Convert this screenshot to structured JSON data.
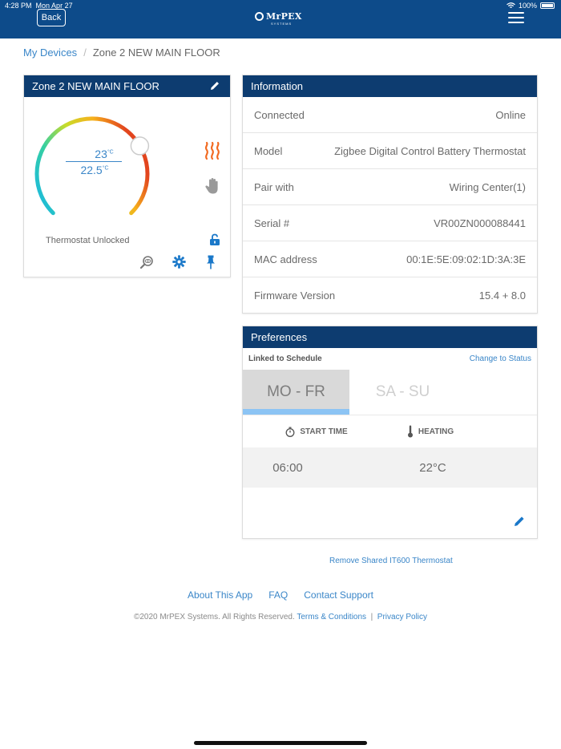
{
  "status_bar": {
    "time": "4:28 PM",
    "date": "Mon Apr 27",
    "battery": "100%"
  },
  "header": {
    "back_label": "Back",
    "logo_text": "MrPEX",
    "logo_sub": "SYSTEMS"
  },
  "breadcrumb": {
    "root": "My Devices",
    "separator": "/",
    "current": "Zone 2 NEW MAIN FLOOR"
  },
  "thermostat": {
    "title": "Zone 2 NEW MAIN FLOOR",
    "setpoint": "23",
    "current_temp": "22.5",
    "unit": "°C",
    "lock_status": "Thermostat Unlocked",
    "dial_level": 0.72
  },
  "information": {
    "title": "Information",
    "rows": [
      {
        "label": "Connected",
        "value": "Online"
      },
      {
        "label": "Model",
        "value": "Zigbee Digital Control Battery Thermostat"
      },
      {
        "label": "Pair with",
        "value": "Wiring Center(1)"
      },
      {
        "label": "Serial #",
        "value": "VR00ZN000088441"
      },
      {
        "label": "MAC address",
        "value": "00:1E:5E:09:02:1D:3A:3E"
      },
      {
        "label": "Firmware Version",
        "value": "15.4 + 8.0"
      }
    ]
  },
  "preferences": {
    "title": "Preferences",
    "linked_label": "Linked to Schedule",
    "change_label": "Change to Status",
    "tabs": [
      "MO - FR",
      "SA - SU"
    ],
    "col_start": "START TIME",
    "col_heating": "HEATING",
    "start_time": "06:00",
    "heating_value": "22°C"
  },
  "footer": {
    "remove_link": "Remove Shared IT600 Thermostat",
    "about": "About This App",
    "faq": "FAQ",
    "contact": "Contact Support",
    "copyright": "©2020   MrPEX Systems. All Rights Reserved.",
    "terms": "Terms & Conditions",
    "divider": "|",
    "privacy": "Privacy Policy"
  },
  "colors": {
    "header": "#0d4b8a",
    "card_header": "#0d3c70",
    "link": "#3a86c8",
    "heat": "#f26a21"
  }
}
